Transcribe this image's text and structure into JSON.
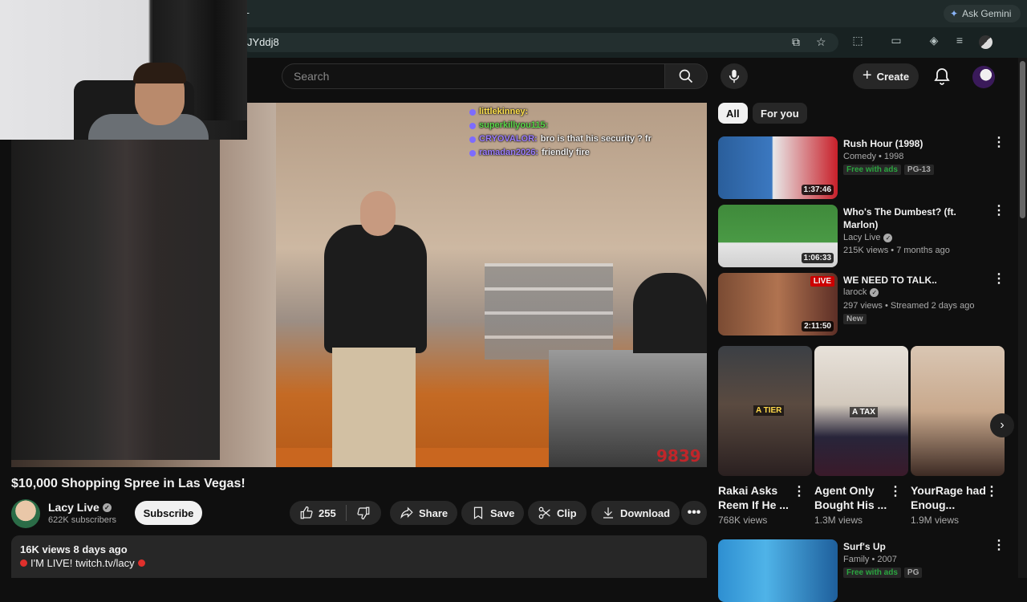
{
  "browser": {
    "new_tab_glyph": "+",
    "gemini_label": "Ask Gemini",
    "url_fragment": "JYddj8"
  },
  "header": {
    "search_placeholder": "Search",
    "create_label": "Create"
  },
  "video": {
    "counter": "9839",
    "chat": [
      {
        "user": "littlekinney:",
        "message": "",
        "color": "#ffe14d"
      },
      {
        "user": "superkillyou115:",
        "message": "",
        "color": "#5ad94a"
      },
      {
        "user": "CRYOVALOR:",
        "message": "bro is that his security ? fr",
        "color": "#9b7dff"
      },
      {
        "user": "ramadan2026:",
        "message": "friendly fire",
        "color": "#9b7dff"
      }
    ],
    "title": "$10,000 Shopping Spree in Las Vegas!"
  },
  "channel": {
    "name": "Lacy Live",
    "subscribers": "622K subscribers",
    "subscribe_label": "Subscribe"
  },
  "actions": {
    "like_count": "255",
    "share_label": "Share",
    "save_label": "Save",
    "clip_label": "Clip",
    "download_label": "Download"
  },
  "description": {
    "meta": "16K views  8 days ago",
    "line": "I'M LIVE! twitch.tv/lacy"
  },
  "sidebar": {
    "chips": [
      "All",
      "For you"
    ],
    "recommendations": [
      {
        "title": "Rush Hour (1998)",
        "sub": "Comedy • 1998",
        "badge1": "Free with ads",
        "badge2": "PG-13",
        "duration": "1:37:46"
      },
      {
        "title": "Who's The Dumbest? (ft. Marlon)",
        "channel": "Lacy Live",
        "sub": "215K views • 7 months ago",
        "duration": "1:06:33"
      },
      {
        "title": "WE NEED TO TALK..",
        "channel": "larock",
        "sub": "297 views • Streamed 2 days ago",
        "badge": "New",
        "live": "LIVE",
        "duration": "2:11:50"
      },
      {
        "title": "Surf's Up",
        "sub": "Family • 2007",
        "badge1": "Free with ads",
        "badge2": "PG"
      }
    ],
    "shorts": [
      {
        "title": "Rakai Asks Reem If He ...",
        "views": "768K views",
        "overlay": "A TIER"
      },
      {
        "title": "Agent Only Bought His ...",
        "views": "1.3M views",
        "overlay": "A TAX"
      },
      {
        "title": "YourRage had Enoug...",
        "views": "1.9M views",
        "overlay": ""
      }
    ]
  }
}
